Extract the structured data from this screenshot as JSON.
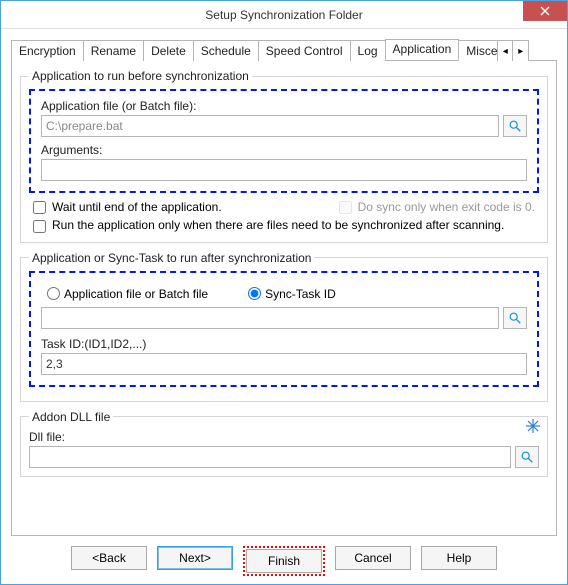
{
  "window": {
    "title": "Setup Synchronization Folder"
  },
  "tabs": {
    "t0": "Encryption",
    "t1": "Rename",
    "t2": "Delete",
    "t3": "Schedule",
    "t4": "Speed Control",
    "t5": "Log",
    "t6": "Application",
    "t7": "Misce"
  },
  "before": {
    "legend": "Application to run before synchronization",
    "file_label": "Application file (or Batch file):",
    "file_value": "C:\\prepare.bat",
    "args_label": "Arguments:",
    "args_value": "",
    "wait_label": "Wait until end of the application.",
    "exit0_label": "Do sync only when exit code is 0.",
    "scan_label": "Run the application only when there are files need to be synchronized after scanning."
  },
  "after": {
    "legend": "Application or Sync-Task to run after synchronization",
    "radio_app": "Application file or Batch file",
    "radio_task": "Sync-Task ID",
    "path_value": "",
    "taskid_label": "Task ID:(ID1,ID2,...)",
    "taskid_value": "2,3"
  },
  "addon": {
    "legend": "Addon DLL file",
    "dll_label": "Dll file:",
    "dll_value": ""
  },
  "buttons": {
    "back": "<Back",
    "next": "Next>",
    "finish": "Finish",
    "cancel": "Cancel",
    "help": "Help"
  }
}
